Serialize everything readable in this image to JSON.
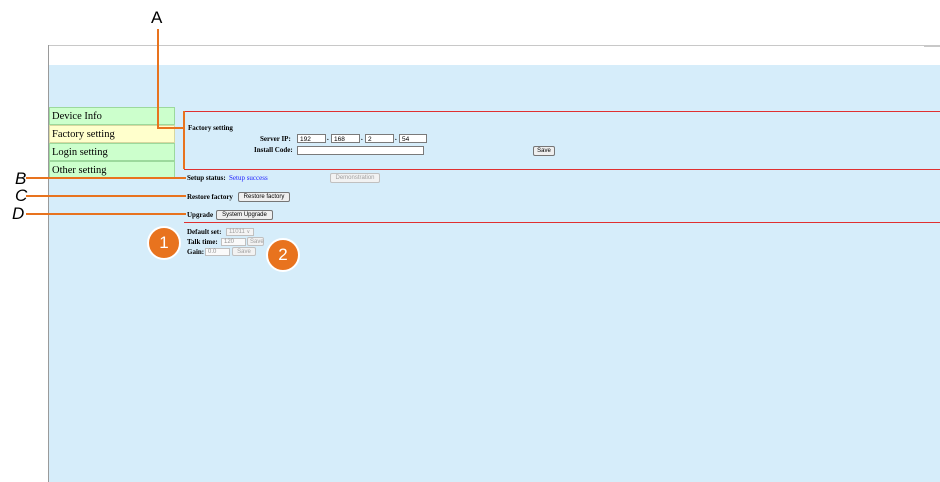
{
  "nav": {
    "items": [
      {
        "label": "Device Info"
      },
      {
        "label": "Factory setting"
      },
      {
        "label": "Login setting"
      },
      {
        "label": "Other setting"
      }
    ]
  },
  "factory": {
    "heading": "Factory setting",
    "server_ip_label": "Server IP:",
    "server_ip": [
      "192",
      "168",
      "2",
      "54"
    ],
    "dot": ".",
    "install_code_label": "Install Code:",
    "install_code": "",
    "save_label": "Save"
  },
  "status": {
    "label": "Setup status:",
    "value": "Setup success",
    "demo_label": "Demonstration"
  },
  "restore": {
    "label": "Restore factory",
    "button": "Restore factory"
  },
  "upgrade": {
    "label": "Upgrade",
    "button": "System Upgrade"
  },
  "audio": {
    "default_set_label": "Default set:",
    "default_set_value": "11011",
    "talk_time_label": "Talk time:",
    "talk_time_value": "120",
    "gain_label": "Gain:",
    "gain_value": "0.0",
    "save_label": "Save"
  },
  "callouts": {
    "a": "A",
    "b": "B",
    "c": "C",
    "d": "D",
    "n1": "1",
    "n2": "2"
  },
  "colors": {
    "panel_bg": "#d6edfa",
    "nav_bg": "#ccffcc",
    "nav_active_bg": "#ffffcc",
    "divider": "#e03030",
    "callout": "#e8731e",
    "status_value": "#1a1aff"
  }
}
